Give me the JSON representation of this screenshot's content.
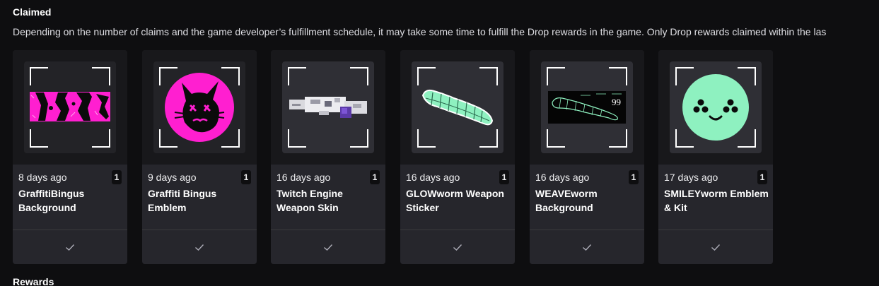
{
  "claimed_section": {
    "title": "Claimed",
    "description": "Depending on the number of claims and the game developer’s fulfillment schedule, it may take some time to fulfill the Drop rewards in the game. Only Drop rewards claimed within the las"
  },
  "rewards_section": {
    "title": "Rewards"
  },
  "cards": [
    {
      "date": "8 days ago",
      "quantity": "1",
      "name": "GraffitiBingus Background",
      "art": "graffiti-bingus-background-art",
      "status_icon": "check-icon"
    },
    {
      "date": "9 days ago",
      "quantity": "1",
      "name": "Graffiti Bingus Emblem",
      "art": "graffiti-bingus-emblem-art",
      "status_icon": "check-icon"
    },
    {
      "date": "16 days ago",
      "quantity": "1",
      "name": "Twitch Engine Weapon Skin",
      "art": "weapon-skin-art",
      "status_icon": "check-icon"
    },
    {
      "date": "16 days ago",
      "quantity": "1",
      "name": "GLOWworm Weapon Sticker",
      "art": "glowworm-sticker-art",
      "status_icon": "check-icon"
    },
    {
      "date": "16 days ago",
      "quantity": "1",
      "name": "WEAVEworm Background",
      "art": "weaveworm-background-art",
      "art_number": "99",
      "status_icon": "check-icon"
    },
    {
      "date": "17 days ago",
      "quantity": "1",
      "name": "SMILEYworm Emblem & Kit",
      "art": "smileyworm-emblem-art",
      "status_icon": "check-icon"
    }
  ],
  "colors": {
    "page_bg": "#0e0e10",
    "card_bg": "#1f1f23",
    "accent_magenta": "#ff1fd0",
    "accent_mint": "#8ef1c0"
  }
}
